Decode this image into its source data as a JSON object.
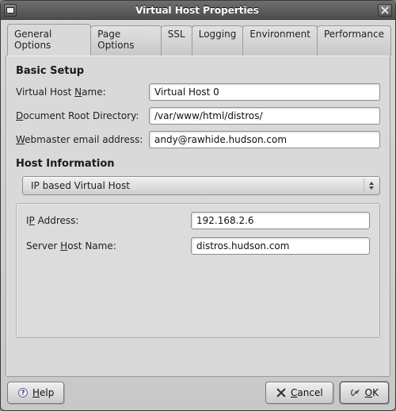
{
  "window": {
    "title": "Virtual Host Properties"
  },
  "tabs": {
    "general": "General Options",
    "page": "Page Options",
    "ssl": "SSL",
    "logging": "Logging",
    "environment": "Environment",
    "performance": "Performance"
  },
  "basic": {
    "section_title": "Basic Setup",
    "vhost_name_label_pre": "Virtual Host ",
    "vhost_name_mn": "N",
    "vhost_name_label_post": "ame:",
    "vhost_name_value": "Virtual Host 0",
    "docroot_label_pre": "",
    "docroot_mn": "D",
    "docroot_label_post": "ocument Root Directory:",
    "docroot_value": "/var/www/html/distros/",
    "webmaster_label_pre": "",
    "webmaster_mn": "W",
    "webmaster_label_post": "ebmaster email address:",
    "webmaster_value": "andy@rawhide.hudson.com"
  },
  "host": {
    "section_title": "Host Information",
    "combo_value": "IP based Virtual Host",
    "ip_label_pre": "I",
    "ip_mn": "P",
    "ip_label_post": " Address:",
    "ip_value": "192.168.2.6",
    "server_label_pre": "Server ",
    "server_mn": "H",
    "server_label_post": "ost Name:",
    "server_value": "distros.hudson.com"
  },
  "buttons": {
    "help_mn": "H",
    "help_post": "elp",
    "cancel_mn": "C",
    "cancel_post": "ancel",
    "ok_mn": "O",
    "ok_post": "K"
  }
}
